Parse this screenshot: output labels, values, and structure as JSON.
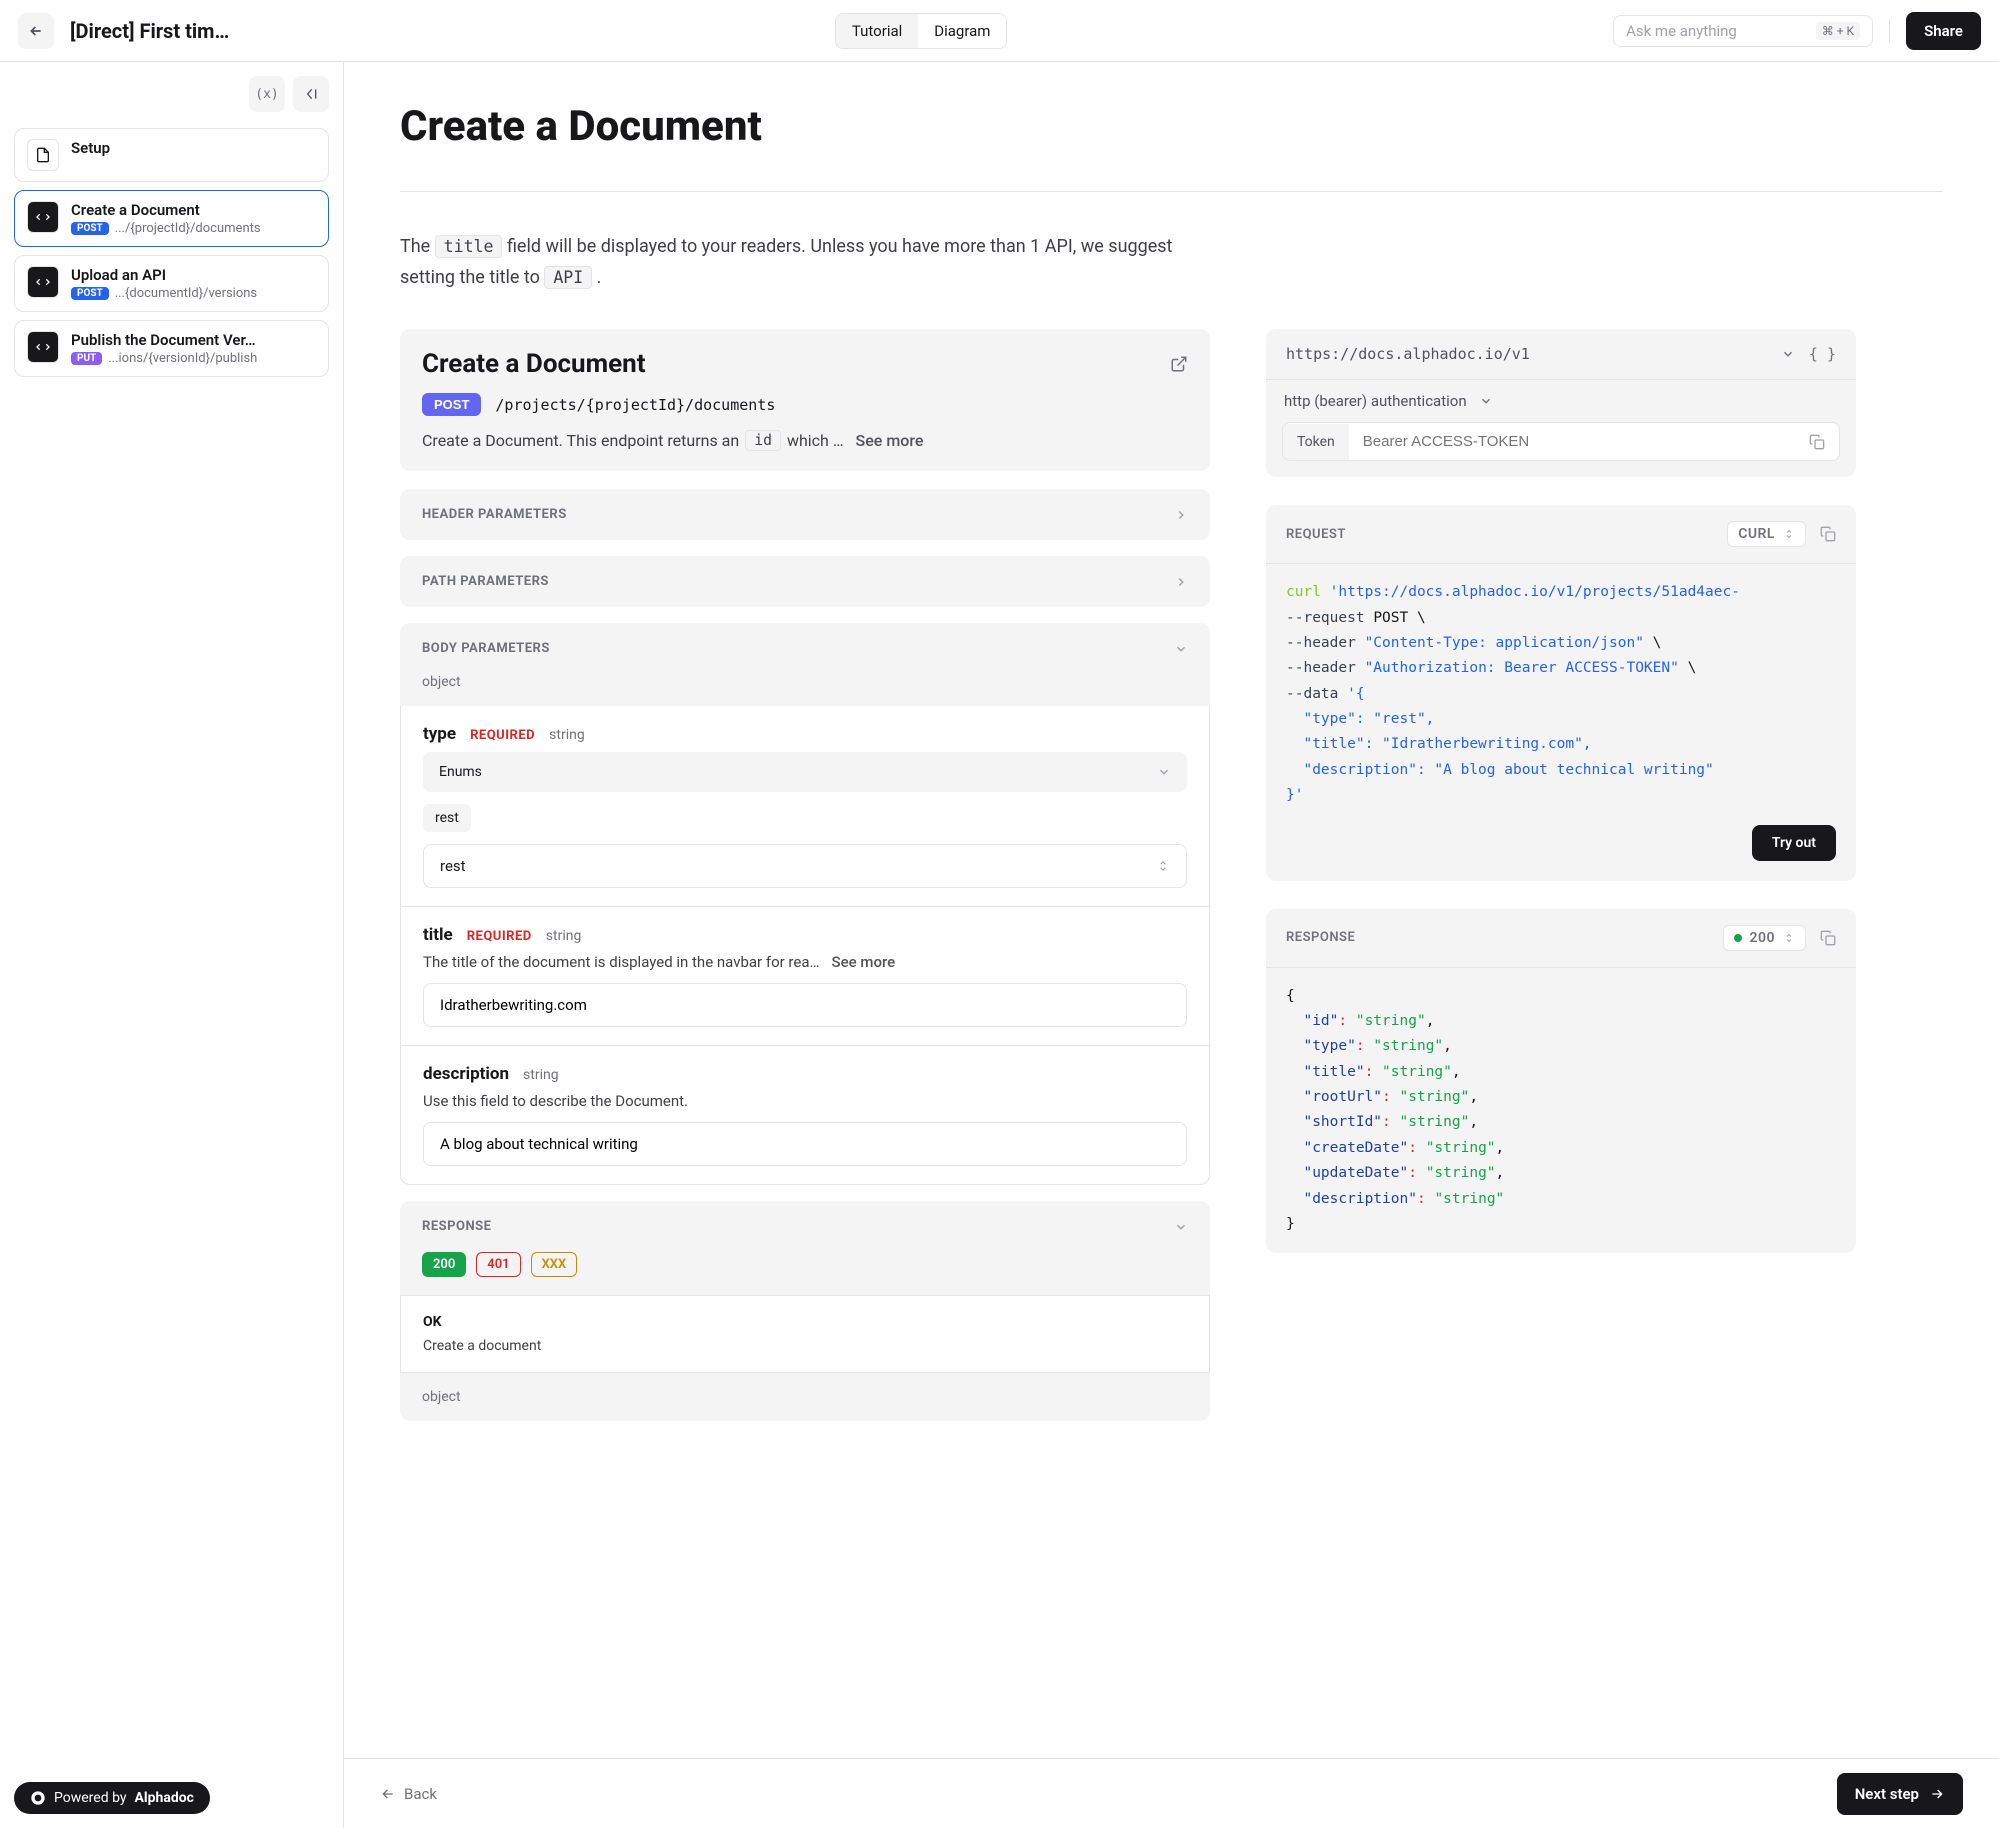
{
  "header": {
    "title": "[Direct] First tim…",
    "toggle": {
      "tutorial": "Tutorial",
      "diagram": "Diagram"
    },
    "search_placeholder": "Ask me anything",
    "search_kbd": "⌘ + K",
    "share": "Share"
  },
  "sidebar": {
    "toolbar": {
      "vars": "(x)"
    },
    "items": [
      {
        "title": "Setup"
      },
      {
        "title": "Create a Document",
        "method": "POST",
        "path": ".../{projectId}/documents"
      },
      {
        "title": "Upload an API",
        "method": "POST",
        "path": "...{documentId}/versions"
      },
      {
        "title": "Publish the Document Ver…",
        "method": "PUT",
        "path": "...ions/{versionId}/publish"
      }
    ],
    "powered_prefix": "Powered by ",
    "powered_brand": "Alphadoc"
  },
  "page": {
    "title": "Create a Document",
    "intro_pre": "The ",
    "intro_code1": "title",
    "intro_mid": " field will be displayed to your readers. Unless you have more than 1 API, we suggest setting the title to ",
    "intro_code2": "API",
    "intro_post": " ."
  },
  "api": {
    "title": "Create a Document",
    "method": "POST",
    "path": "/projects/{projectId}/documents",
    "desc_pre": "Create a Document. This endpoint returns an ",
    "desc_code": "id",
    "desc_post": " which …",
    "see_more": "See more",
    "sections": {
      "header_params": "HEADER PARAMETERS",
      "path_params": "PATH PARAMETERS",
      "body_params": "BODY PARAMETERS",
      "response": "RESPONSE"
    },
    "body": {
      "object": "object",
      "fields": [
        {
          "name": "type",
          "required": "REQUIRED",
          "type": "string",
          "enums_label": "Enums",
          "enum_value": "rest",
          "select_value": "rest"
        },
        {
          "name": "title",
          "required": "REQUIRED",
          "type": "string",
          "desc": "The title of the document is displayed in the navbar for rea…",
          "see_more": "See more",
          "value": "Idratherbewriting.com"
        },
        {
          "name": "description",
          "type": "string",
          "desc": "Use this field to describe the Document.",
          "value": "A blog about technical writing"
        }
      ]
    },
    "response": {
      "codes": [
        "200",
        "401",
        "XXX"
      ],
      "ok_title": "OK",
      "ok_desc": "Create a document",
      "object": "object"
    }
  },
  "right": {
    "base_url": "https://docs.alphadoc.io/v1",
    "braces": "{ }",
    "auth_label": "http (bearer) authentication",
    "token_label": "Token",
    "token_placeholder": "Bearer ACCESS-TOKEN",
    "request_label": "REQUEST",
    "lang": "CURL",
    "curl": {
      "cmd": "curl",
      "url": "'https://docs.alphadoc.io/v1/projects/51ad4aec-",
      "l2a": "--request",
      "l2b": "POST \\",
      "l3a": "--header",
      "l3b": "\"Content-Type: application/json\"",
      "l3c": " \\",
      "l4a": "--header",
      "l4b": "\"Authorization: Bearer ACCESS-TOKEN\"",
      "l4c": " \\",
      "l5a": "--data",
      "l5b": "'{",
      "l6": "  \"type\": \"rest\",",
      "l7": "  \"title\": \"Idratherbewriting.com\",",
      "l8": "  \"description\": \"A blog about technical writing\"",
      "l9": "}'"
    },
    "try_out": "Try out",
    "response_label": "RESPONSE",
    "response_status": "200",
    "json": {
      "open": "{",
      "lines": [
        {
          "k": "\"id\"",
          "v": "\"string\"",
          "c": ","
        },
        {
          "k": "\"type\"",
          "v": "\"string\"",
          "c": ","
        },
        {
          "k": "\"title\"",
          "v": "\"string\"",
          "c": ","
        },
        {
          "k": "\"rootUrl\"",
          "v": "\"string\"",
          "c": ","
        },
        {
          "k": "\"shortId\"",
          "v": "\"string\"",
          "c": ","
        },
        {
          "k": "\"createDate\"",
          "v": "\"string\"",
          "c": ","
        },
        {
          "k": "\"updateDate\"",
          "v": "\"string\"",
          "c": ","
        },
        {
          "k": "\"description\"",
          "v": "\"string\"",
          "c": ""
        }
      ],
      "close": "}"
    }
  },
  "footer": {
    "back": "Back",
    "next": "Next step"
  }
}
